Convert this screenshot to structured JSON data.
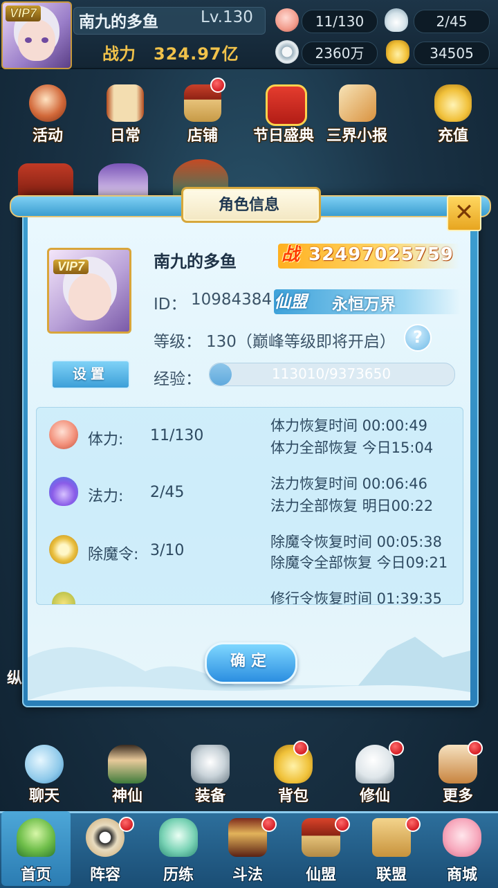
{
  "topbar": {
    "vip": "VIP7",
    "name": "南九的多鱼",
    "level": "Lv.130",
    "power_label": "战力",
    "power_value": "324.97亿",
    "resources": [
      {
        "icon": "peach-icon",
        "value": "11/130"
      },
      {
        "icon": "flame-icon",
        "value": "2/45"
      },
      {
        "icon": "silver-coin-icon",
        "value": "2360万"
      },
      {
        "icon": "gold-ingot-icon",
        "value": "34505"
      }
    ]
  },
  "top_icons": [
    "活动",
    "日常",
    "店铺",
    "节日盛典",
    "三界小报",
    "充值"
  ],
  "dialog": {
    "title": "角色信息",
    "name": "南九的多鱼",
    "vip": "VIP7",
    "power_badge": "战",
    "power": "32497025759",
    "id_label": "ID：",
    "id_value": "10984384",
    "guild_badge": "仙盟",
    "guild_name": "永恒万界",
    "level_label": "等级：",
    "level_value": "130（巅峰等级即将开启）",
    "settings_label": "设置",
    "exp_label": "经验：",
    "exp_text": "113010/9373650",
    "exp_ratio": 0.012,
    "stats": [
      {
        "icon": "peach-icon",
        "name": "体力:",
        "value": "11/130",
        "line1": "体力恢复时间 00:00:49",
        "line2": "体力全部恢复 今日15:04"
      },
      {
        "icon": "purple-flame-icon",
        "name": "法力:",
        "value": "2/45",
        "line1": "法力恢复时间 00:06:46",
        "line2": "法力全部恢复 明日00:22"
      },
      {
        "icon": "token-icon",
        "name": "除魔令:",
        "value": "3/10",
        "line1": "除魔令恢复时间 00:05:38",
        "line2": "除魔令全部恢复 今日09:21"
      },
      {
        "icon": "practice-token-icon",
        "name": "",
        "value": "",
        "line1": "修行令恢复时间 01:39:35",
        "line2": ""
      }
    ],
    "confirm_label": "确定"
  },
  "features": [
    "聊天",
    "神仙",
    "装备",
    "背包",
    "修仙",
    "更多"
  ],
  "nav": [
    "首页",
    "阵容",
    "历练",
    "斗法",
    "仙盟",
    "联盟",
    "商城"
  ],
  "side_text": "纵"
}
